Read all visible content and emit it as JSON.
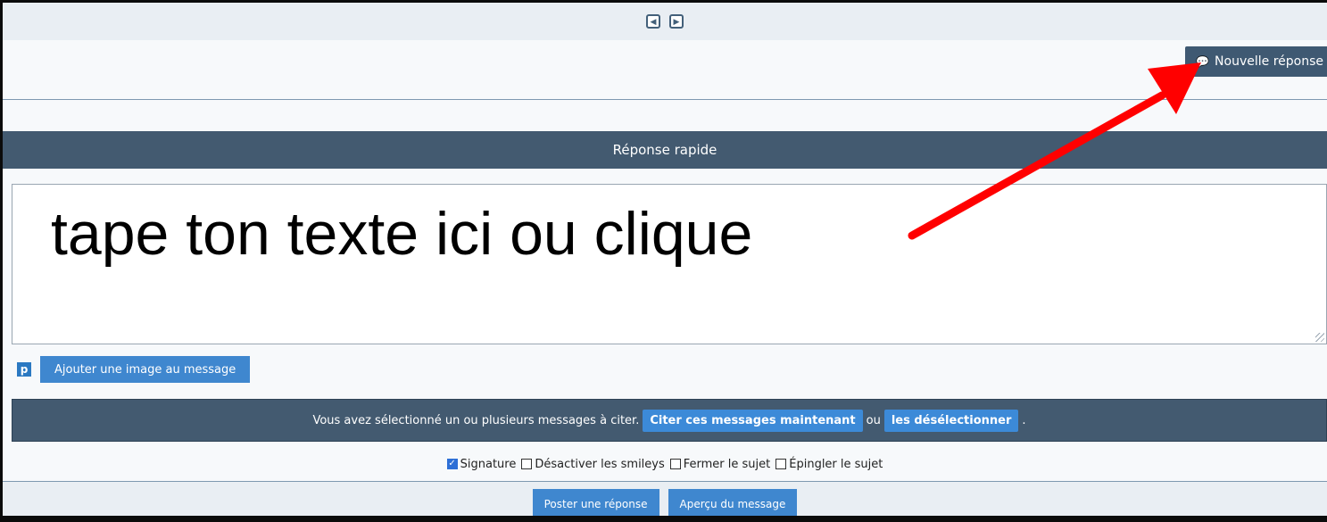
{
  "nav": {
    "prev_icon": "arrow-left-icon",
    "next_icon": "arrow-right-icon"
  },
  "toolbar": {
    "new_reply_label": "Nouvelle réponse",
    "new_reply_icon": "chat-bubbles-icon"
  },
  "quick_reply": {
    "title": "Réponse rapide"
  },
  "editor": {
    "text": "tape ton texte ici ou clique"
  },
  "image": {
    "icon": "p-icon",
    "icon_glyph": "p",
    "add_label": "Ajouter une image au message"
  },
  "quote": {
    "message": "Vous avez sélectionné un ou plusieurs messages à citer.",
    "cite_label": "Citer ces messages maintenant",
    "or_label": "ou",
    "deselect_label": "les désélectionner",
    "end": "."
  },
  "options": [
    {
      "label": "Signature",
      "checked": true
    },
    {
      "label": "Désactiver les smileys",
      "checked": false
    },
    {
      "label": "Fermer le sujet",
      "checked": false
    },
    {
      "label": "Épingler le sujet",
      "checked": false
    }
  ],
  "actions": {
    "post_label": "Poster une réponse",
    "preview_label": "Aperçu du message"
  },
  "colors": {
    "header": "#435a70",
    "button": "#3f87cf",
    "annotation_arrow": "#ff0000"
  }
}
